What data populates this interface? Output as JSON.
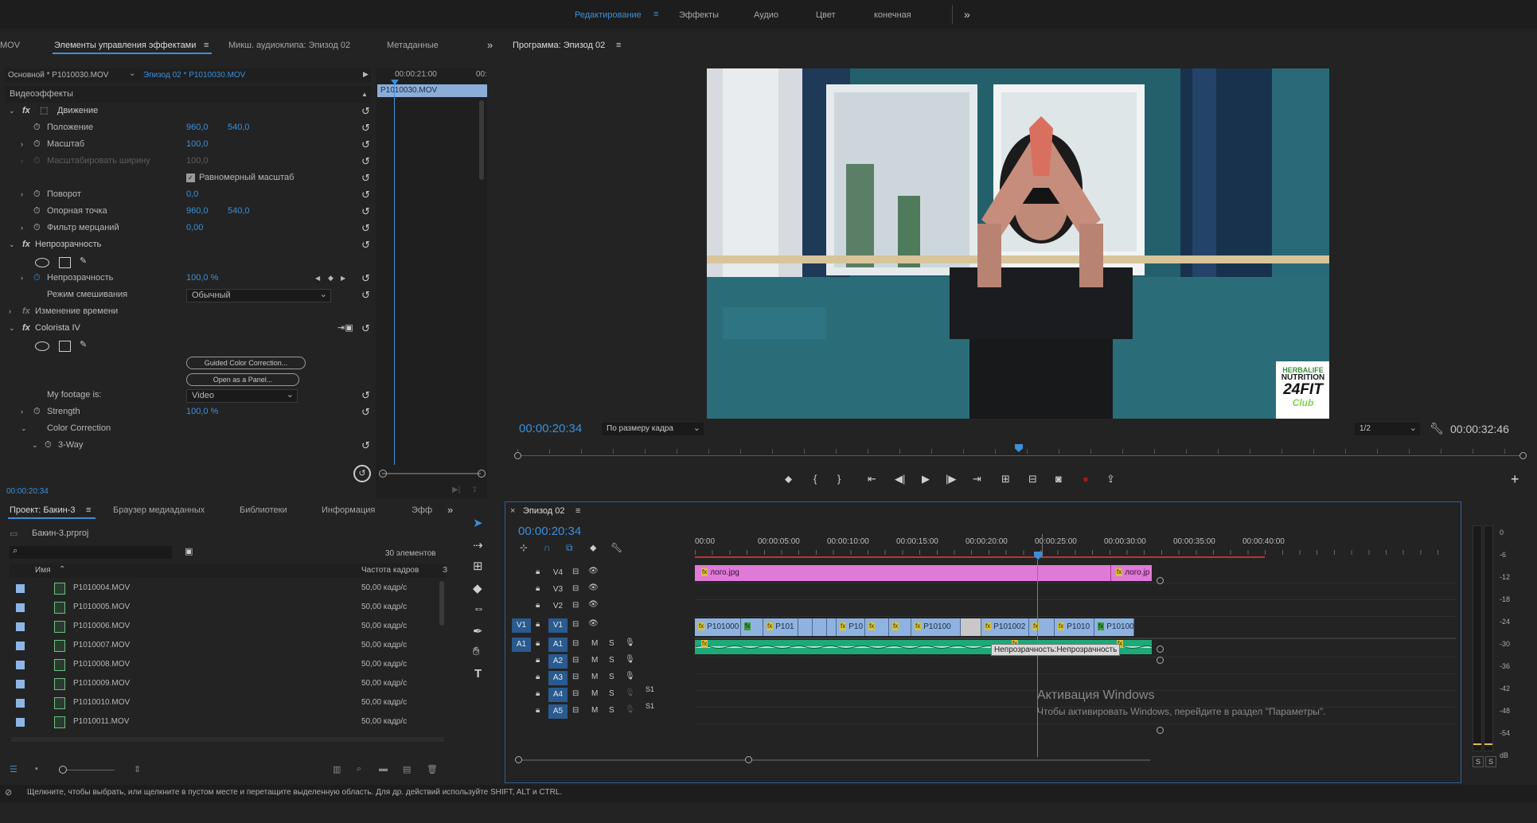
{
  "workspaces": {
    "tabs": [
      "Редактирование",
      "Эффекты",
      "Аудио",
      "Цвет",
      "конечная"
    ],
    "active": "Редактирование",
    "more": "»"
  },
  "effect_controls": {
    "left_cut": "MOV",
    "tabs": [
      "Элементы управления эффектами",
      "Микш. аудиоклипа: Эпизод 02",
      "Метаданные"
    ],
    "source_master": "Основной * P1010030.MOV",
    "source_seq": "Эпизод 02 * P1010030.MOV",
    "ruler_time": "00:00:21:00",
    "ruler_time2": "00:",
    "clip_name": "P1010030.MOV",
    "section": "Видеоэффекты",
    "motion": "Движение",
    "position_label": "Положение",
    "position_x": "960,0",
    "position_y": "540,0",
    "scale_label": "Масштаб",
    "scale_val": "100,0",
    "scale_width_label": "Масштабировать ширину",
    "scale_width_val": "100,0",
    "uniform_label": "Равномерный масштаб",
    "rotation_label": "Поворот",
    "rotation_val": "0,0",
    "anchor_label": "Опорная точка",
    "anchor_x": "960,0",
    "anchor_y": "540,0",
    "flicker_label": "Фильтр мерцаний",
    "flicker_val": "0,00",
    "opacity_group": "Непрозрачность",
    "opacity_label": "Непрозрачность",
    "opacity_val": "100,0 %",
    "blend_label": "Режим смешивания",
    "blend_val": "Обычный",
    "time_remap": "Изменение времени",
    "colorista": "Colorista IV",
    "guided_btn": "Guided Color Correction...",
    "open_panel_btn": "Open as a Panel...",
    "footage_label": "My footage is:",
    "footage_val": "Video",
    "strength_label": "Strength",
    "strength_val": "100,0 %",
    "color_correction": "Color Correction",
    "three_way": "3-Way",
    "timecode": "00:00:20:34"
  },
  "program": {
    "title": "Программа: Эпизод 02",
    "timecode": "00:00:20:34",
    "fit": "По размеру кадра",
    "resolution": "1/2",
    "duration": "00:00:32:46",
    "logo_line1": "HERBALIFE",
    "logo_line2": "NUTRITION",
    "logo_line3": "24FIT",
    "logo_line4": "Club"
  },
  "project": {
    "tabs": [
      "Проект: Бакин-3",
      "Браузер медиаданных",
      "Библиотеки",
      "Информация",
      "Эфф"
    ],
    "file": "Бакин-3.prproj",
    "count": "30 элементов",
    "col_name": "Имя",
    "col_fps": "Частота кадров",
    "col_3": "З",
    "items": [
      {
        "name": "P1010004.MOV",
        "fps": "50,00 кадр/с"
      },
      {
        "name": "P1010005.MOV",
        "fps": "50,00 кадр/с"
      },
      {
        "name": "P1010006.MOV",
        "fps": "50,00 кадр/с"
      },
      {
        "name": "P1010007.MOV",
        "fps": "50,00 кадр/с"
      },
      {
        "name": "P1010008.MOV",
        "fps": "50,00 кадр/с"
      },
      {
        "name": "P1010009.MOV",
        "fps": "50,00 кадр/с"
      },
      {
        "name": "P1010010.MOV",
        "fps": "50,00 кадр/с"
      },
      {
        "name": "P1010011.MOV",
        "fps": "50,00 кадр/с"
      }
    ]
  },
  "timeline": {
    "title": "Эпизод 02",
    "timecode": "00:00:20:34",
    "ruler": [
      "00:00",
      "00:00:05:00",
      "00:00:10:00",
      "00:00:15:00",
      "00:00:20:00",
      "00:00:25:00",
      "00:00:30:00",
      "00:00:35:00",
      "00:00:40:00"
    ],
    "tracks_v": [
      "V4",
      "V3",
      "V2",
      "V1"
    ],
    "tracks_a": [
      "A1",
      "A2",
      "A3",
      "A4",
      "A5"
    ],
    "v1_src": "V1",
    "a1_src": "A1",
    "m": "M",
    "s": "S",
    "s1": "S1",
    "clip_logo1": "лого.jpg",
    "clip_logo2": "лого.jp",
    "v1_clips": [
      "P101000",
      "P101",
      "P10",
      "P10100",
      "P101002",
      "P1010",
      "P10100"
    ],
    "tooltip": "Непрозрачность:Непрозрачность",
    "watermark_title": "Активация Windows",
    "watermark_text": "Чтобы активировать Windows, перейдите в раздел \"Параметры\"."
  },
  "meter": {
    "labels": [
      "0",
      "-6",
      "-12",
      "-18",
      "-24",
      "-30",
      "-36",
      "-42",
      "-48",
      "-54",
      "dB"
    ],
    "solo1": "S",
    "solo2": "S"
  },
  "status_bar": "Щелкните, чтобы выбрать, или щелкните в пустом месте и перетащите выделенную область. Для др. действий используйте SHIFT, ALT и CTRL."
}
